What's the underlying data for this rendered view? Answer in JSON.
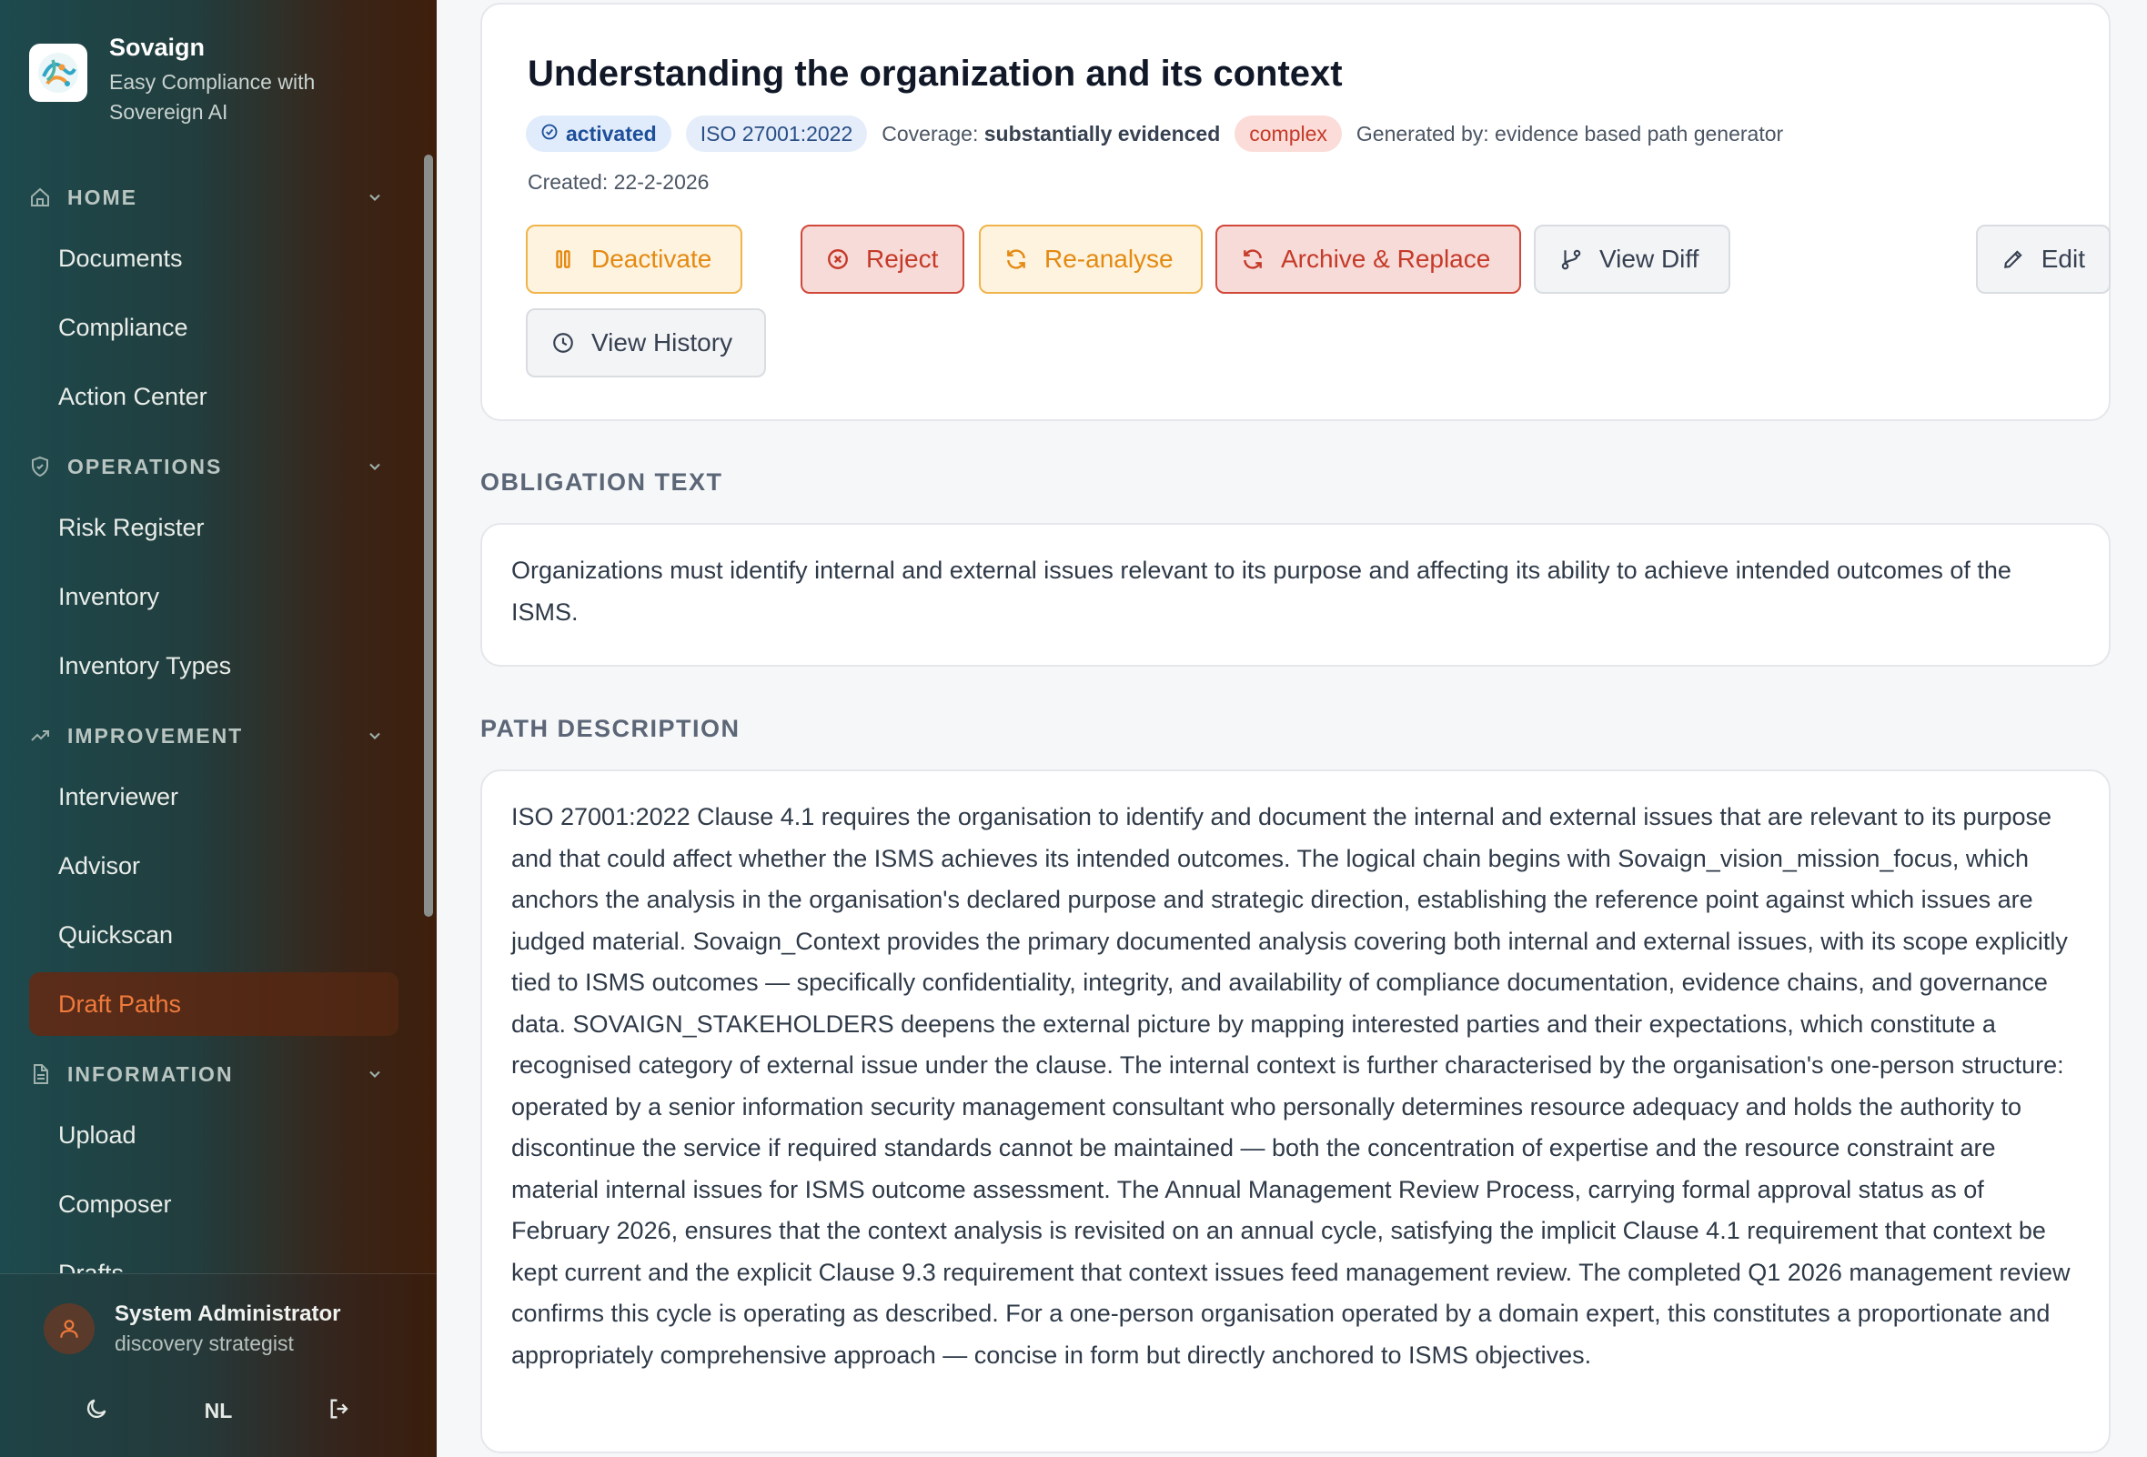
{
  "app": {
    "name": "Sovaign",
    "tagline": "Easy Compliance with Sovereign AI"
  },
  "sidebar": {
    "sections": [
      {
        "label": "HOME",
        "icon": "home-icon",
        "items": [
          "Documents",
          "Compliance",
          "Action Center"
        ]
      },
      {
        "label": "OPERATIONS",
        "icon": "shield-icon",
        "items": [
          "Risk Register",
          "Inventory",
          "Inventory Types"
        ]
      },
      {
        "label": "IMPROVEMENT",
        "icon": "trending-up-icon",
        "items": [
          "Interviewer",
          "Advisor",
          "Quickscan",
          "Draft Paths"
        ]
      },
      {
        "label": "INFORMATION",
        "icon": "file-text-icon",
        "items": [
          "Upload",
          "Composer",
          "Drafts"
        ]
      }
    ],
    "active_item": "Draft Paths"
  },
  "user": {
    "name": "System Administrator",
    "role": "discovery strategist",
    "language": "NL"
  },
  "path": {
    "title": "Understanding the organization and its context",
    "status": "activated",
    "standard": "ISO 27001:2022",
    "coverage_label": "Coverage:",
    "coverage_value": "substantially evidenced",
    "complexity": "complex",
    "generated_by": "Generated by: evidence based path generator",
    "created": "Created: 22-2-2026"
  },
  "actions": {
    "deactivate": "Deactivate",
    "reject": "Reject",
    "reanalyse": "Re-analyse",
    "archive_replace": "Archive & Replace",
    "view_diff": "View Diff",
    "edit": "Edit",
    "view_history": "View History"
  },
  "obligation": {
    "heading": "OBLIGATION TEXT",
    "text": "Organizations must identify internal and external issues relevant to its purpose and affecting its ability to achieve intended outcomes of the ISMS."
  },
  "description": {
    "heading": "PATH DESCRIPTION",
    "text": "ISO 27001:2022 Clause 4.1 requires the organisation to identify and document the internal and external issues that are relevant to its purpose and that could affect whether the ISMS achieves its intended outcomes. The logical chain begins with Sovaign_vision_mission_focus, which anchors the analysis in the organisation's declared purpose and strategic direction, establishing the reference point against which issues are judged material. Sovaign_Context provides the primary documented analysis covering both internal and external issues, with its scope explicitly tied to ISMS outcomes — specifically confidentiality, integrity, and availability of compliance documentation, evidence chains, and governance data. SOVAIGN_STAKEHOLDERS deepens the external picture by mapping interested parties and their expectations, which constitute a recognised category of external issue under the clause. The internal context is further characterised by the organisation's one-person structure: operated by a senior information security management consultant who personally determines resource adequacy and holds the authority to discontinue the service if required standards cannot be maintained — both the concentration of expertise and the resource constraint are material internal issues for ISMS outcome assessment. The Annual Management Review Process, carrying formal approval status as of February 2026, ensures that the context analysis is revisited on an annual cycle, satisfying the implicit Clause 4.1 requirement that context be kept current and the explicit Clause 9.3 requirement that context issues feed management review. The completed Q1 2026 management review confirms this cycle is operating as described. For a one-person organisation operated by a domain expert, this constitutes a proportionate and appropriately comprehensive approach — concise in form but directly anchored to ISMS objectives."
  },
  "colors": {
    "accent_orange": "#f07a3c",
    "warning": "#e48a12",
    "danger": "#c53a29",
    "info": "#1e4f9a"
  }
}
